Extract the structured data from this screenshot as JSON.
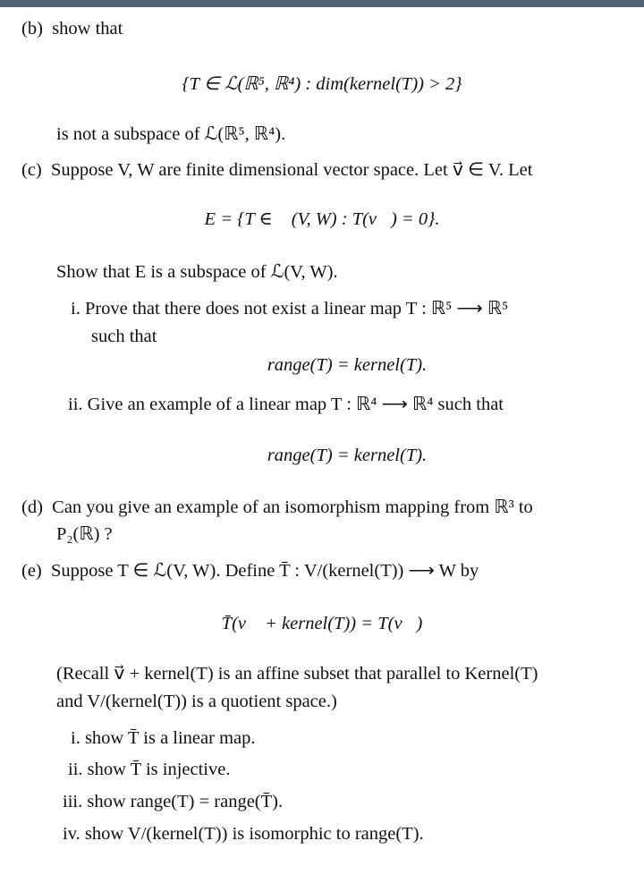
{
  "document": {
    "part_b": {
      "label": "(b)",
      "intro": "show that",
      "set_expr": "{T ∈ ℒ(ℝ⁵, ℝ⁴) : dim(kernel(T)) > 2}",
      "conclusion": "is not a subspace of ℒ(ℝ⁵, ℝ⁴)."
    },
    "part_c": {
      "label": "(c)",
      "intro": "Suppose V, W are finite dimensional vector space. Let v⃗ ∈ V. Let",
      "set_expr": "E = {T ∈ ℒ(V, W) : T(v⃗) = 0}.",
      "task": "Show that E is a subspace of ℒ(V, W).",
      "subitems": [
        {
          "label": "i.",
          "line1": "Prove that there does not exist a linear map T : ℝ⁵ ⟶ ℝ⁵",
          "line2": "such that",
          "display": "range(T) = kernel(T)."
        },
        {
          "label": "ii.",
          "line1": "Give an example of a linear map T : ℝ⁴ ⟶ ℝ⁴ such that",
          "display": "range(T) = kernel(T)."
        }
      ]
    },
    "part_d": {
      "label": "(d)",
      "line1": "Can you give an example of an isomorphism mapping from ℝ³ to",
      "line2": "P₂(ℝ) ?"
    },
    "part_e": {
      "label": "(e)",
      "intro": "Suppose T ∈ ℒ(V, W). Define T̄ : V/(kernel(T)) ⟶ W by",
      "display": "T̄(v⃗ + kernel(T)) = T(v⃗)",
      "recall_line1": "(Recall v⃗ + kernel(T) is an affine subset that parallel to Kernel(T)",
      "recall_line2": "and V/(kernel(T)) is a quotient space.)",
      "subitems": [
        {
          "label": "i.",
          "text": "show T̄ is a linear map."
        },
        {
          "label": "ii.",
          "text": "show T̄ is injective."
        },
        {
          "label": "iii.",
          "text": "show range(T) = range(T̄)."
        },
        {
          "label": "iv.",
          "text": "show V/(kernel(T)) is isomorphic to range(T)."
        }
      ]
    }
  }
}
